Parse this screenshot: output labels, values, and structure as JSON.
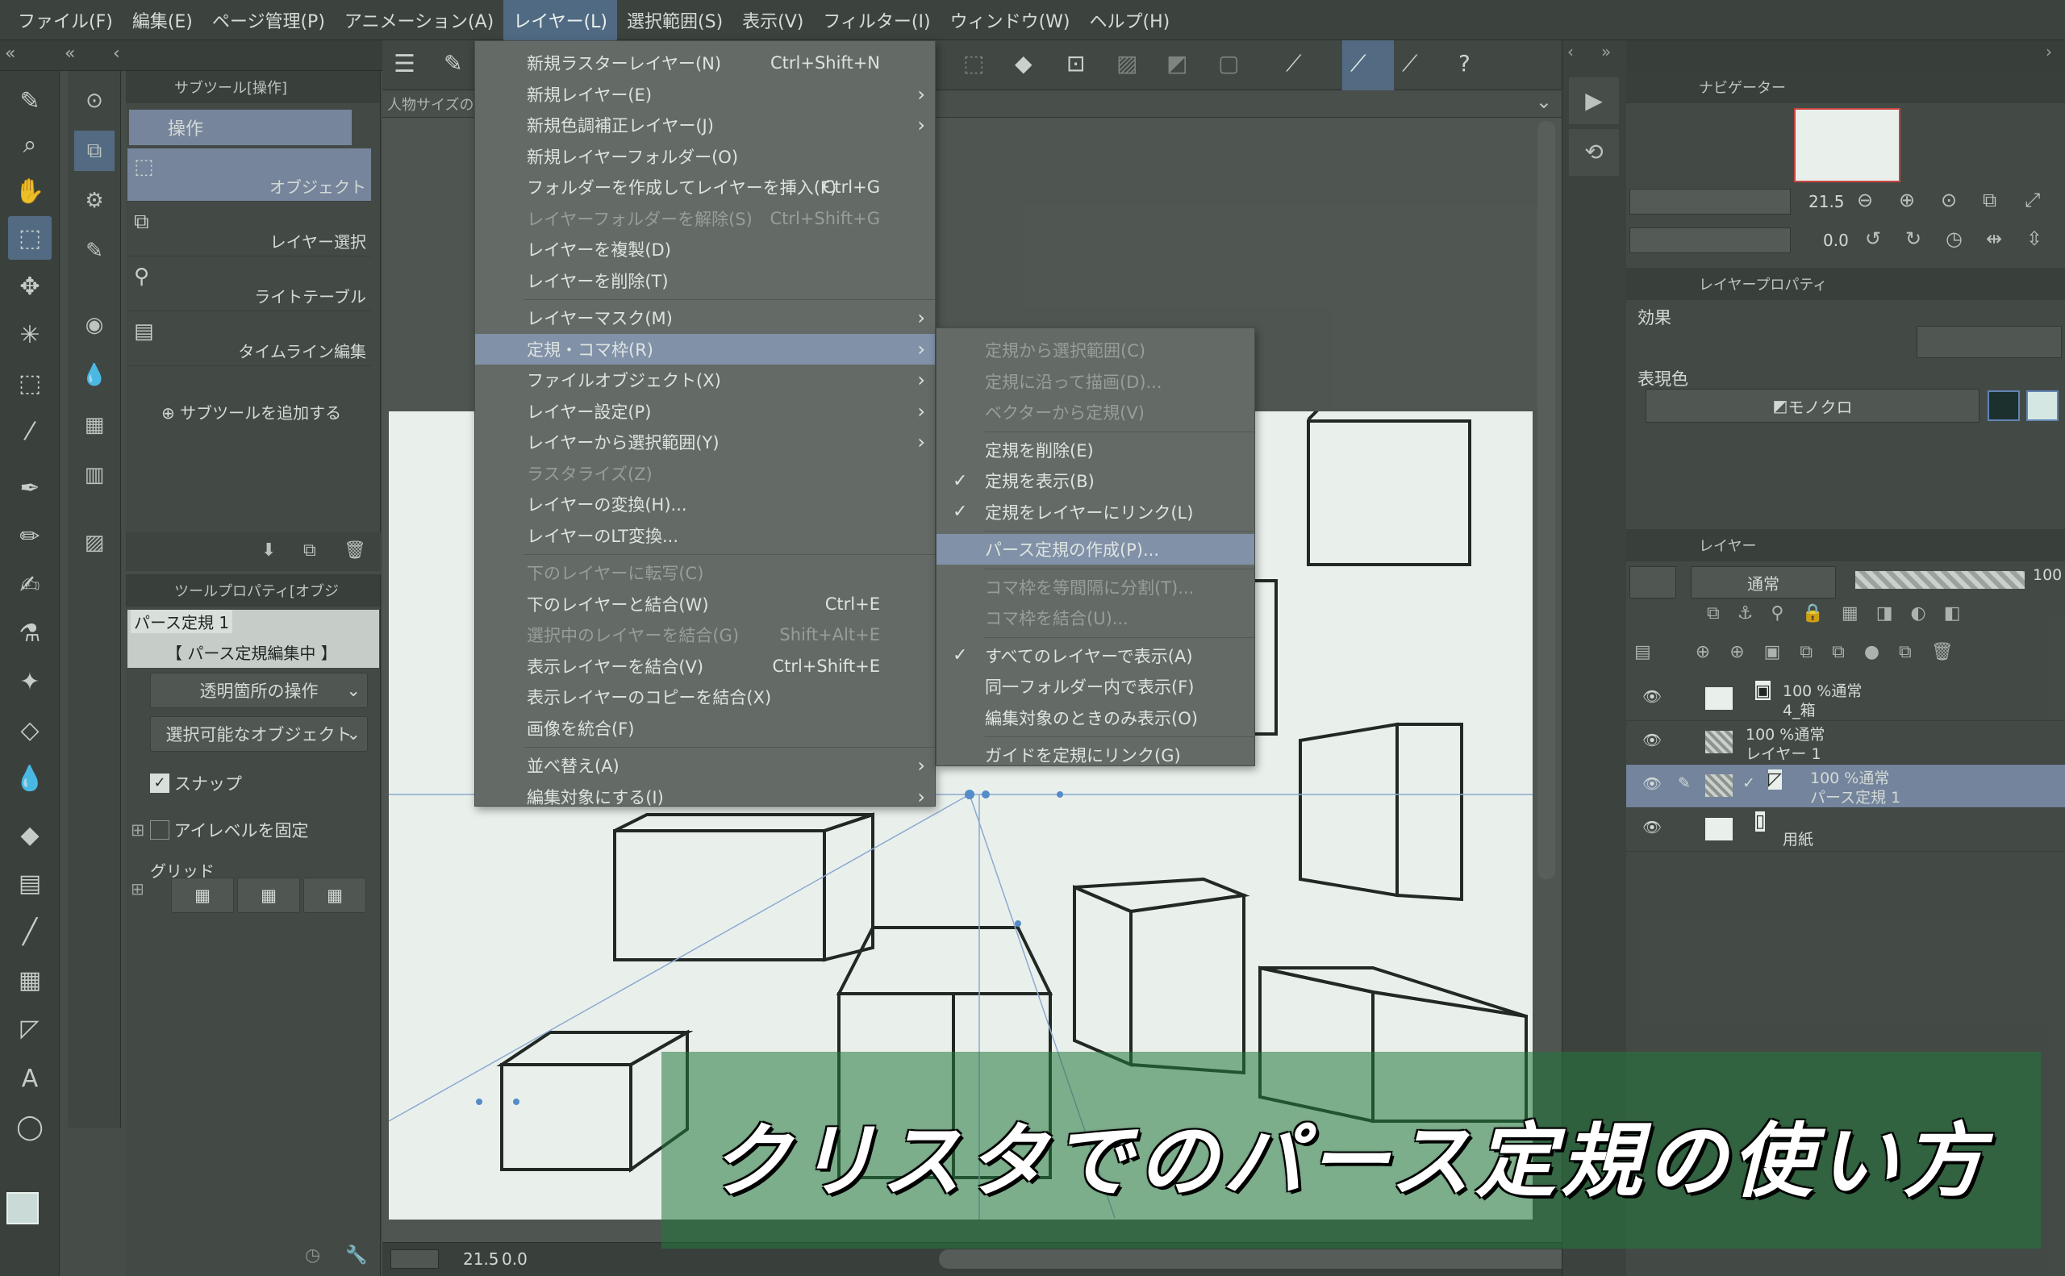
{
  "menubar": [
    "ファイル(F)",
    "編集(E)",
    "ページ管理(P)",
    "アニメーション(A)",
    "レイヤー(L)",
    "選択範囲(S)",
    "表示(V)",
    "フィルター(I)",
    "ウィンドウ(W)",
    "ヘルプ(H)"
  ],
  "subtool": {
    "title": "サブツール[操作]",
    "group": "操作",
    "items": [
      "オブジェクト",
      "レイヤー選択",
      "ライトテーブル",
      "タイムライン編集"
    ],
    "add": "サブツールを追加する"
  },
  "toolprop": {
    "title": "ツールプロパティ[オブジ",
    "layer_name": "パース定規 1",
    "editing": "【 パース定規編集中 】",
    "transparent_op": "透明箇所の操作",
    "selectable": "選択可能なオブジェクト",
    "snap": "スナップ",
    "eye_level": "アイレベルを固定",
    "grid": "グリッド"
  },
  "canvas_tab": "人物サイズの",
  "navigator": {
    "title": "ナビゲーター",
    "zoom": "21.5",
    "angle": "0.0"
  },
  "layer_prop": {
    "title": "レイヤープロパティ",
    "effect": "効果",
    "color_label": "表現色",
    "color_value": "モノクロ"
  },
  "layers": {
    "title": "レイヤー",
    "blend": "通常",
    "opacity": "100",
    "rows": [
      {
        "line1": "100 %通常",
        "line2": "4_箱"
      },
      {
        "line1": "100 %通常",
        "line2": "レイヤー 1"
      },
      {
        "line1": "100 %通常",
        "line2": "パース定規 1"
      },
      {
        "line1": "用紙",
        "line2": ""
      }
    ]
  },
  "layer_menu": {
    "items": [
      {
        "label": "新規ラスターレイヤー(N)",
        "shortcut": "Ctrl+Shift+N"
      },
      {
        "label": "新規レイヤー(E)",
        "arrow": true
      },
      {
        "label": "新規色調補正レイヤー(J)",
        "arrow": true
      },
      {
        "label": "新規レイヤーフォルダー(O)"
      },
      {
        "label": "フォルダーを作成してレイヤーを挿入(F)",
        "shortcut": "Ctrl+G"
      },
      {
        "label": "レイヤーフォルダーを解除(S)",
        "shortcut": "Ctrl+Shift+G",
        "disabled": true
      },
      {
        "label": "レイヤーを複製(D)"
      },
      {
        "label": "レイヤーを削除(T)"
      },
      {
        "label": "レイヤーマスク(M)",
        "arrow": true
      },
      {
        "label": "定規・コマ枠(R)",
        "arrow": true,
        "highlight": true
      },
      {
        "label": "ファイルオブジェクト(X)",
        "arrow": true
      },
      {
        "label": "レイヤー設定(P)",
        "arrow": true
      },
      {
        "label": "レイヤーから選択範囲(Y)",
        "arrow": true
      },
      {
        "label": "ラスタライズ(Z)",
        "disabled": true
      },
      {
        "label": "レイヤーの変換(H)..."
      },
      {
        "label": "レイヤーのLT変換..."
      },
      {
        "label": "下のレイヤーに転写(C)",
        "disabled": true
      },
      {
        "label": "下のレイヤーと結合(W)",
        "shortcut": "Ctrl+E"
      },
      {
        "label": "選択中のレイヤーを結合(G)",
        "shortcut": "Shift+Alt+E",
        "disabled": true
      },
      {
        "label": "表示レイヤーを結合(V)",
        "shortcut": "Ctrl+Shift+E"
      },
      {
        "label": "表示レイヤーのコピーを結合(X)"
      },
      {
        "label": "画像を統合(F)"
      },
      {
        "label": "並べ替え(A)",
        "arrow": true
      },
      {
        "label": "編集対象にする(I)",
        "arrow": true
      }
    ]
  },
  "ruler_menu": {
    "items": [
      {
        "label": "定規から選択範囲(C)",
        "disabled": true
      },
      {
        "label": "定規に沿って描画(D)...",
        "disabled": true
      },
      {
        "label": "ベクターから定規(V)",
        "disabled": true
      },
      {
        "label": "定規を削除(E)"
      },
      {
        "label": "定規を表示(B)",
        "checked": true
      },
      {
        "label": "定規をレイヤーにリンク(L)",
        "checked": true
      },
      {
        "label": "パース定規の作成(P)...",
        "highlight": true
      },
      {
        "label": "コマ枠を等間隔に分割(T)...",
        "disabled": true
      },
      {
        "label": "コマ枠を結合(U)...",
        "disabled": true
      },
      {
        "label": "すべてのレイヤーで表示(A)",
        "checked": true
      },
      {
        "label": "同一フォルダー内で表示(F)"
      },
      {
        "label": "編集対象のときのみ表示(O)"
      },
      {
        "label": "ガイドを定規にリンク(G)"
      }
    ]
  },
  "statusbar": {
    "zoom": "21.5",
    "angle": "0.0"
  },
  "caption": "クリスタでのパース定規の使い方",
  "colors": {
    "menu_bg": "#6b6b6b",
    "highlight": "#8c96b4",
    "selection": "#586b8a",
    "caption_bg": "#2f7a45"
  }
}
